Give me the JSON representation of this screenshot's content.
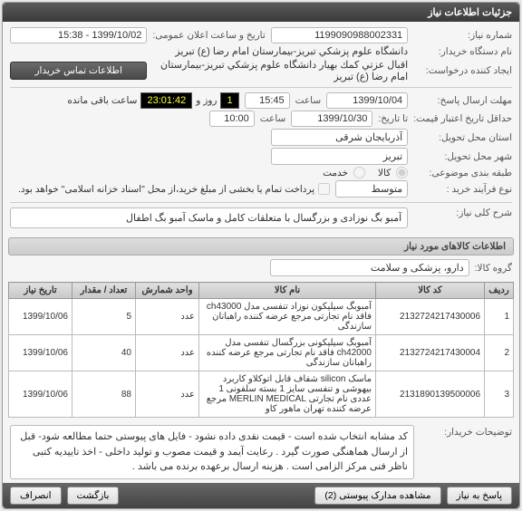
{
  "panel_title": "جزئیات اطلاعات نیاز",
  "fields": {
    "need_no_label": "شماره نیاز:",
    "need_no": "1199090988002331",
    "announce_label": "تاریخ و ساعت اعلان عمومی:",
    "announce": "1399/10/02 - 15:38",
    "buyer_org_label": "نام دستگاه خریدار:",
    "buyer_org": "دانشگاه علوم پزشكي تبريز-بیمارستان امام رضا (ع) تبریز",
    "creator_label": "ایجاد کننده درخواست:",
    "creator": "اقبال عزتي كمك بهيار دانشگاه علوم پزشكي تبريز-بیمارستان امام رضا (ع) تبریز",
    "contact_btn": "اطلاعات تماس خریدار",
    "deadline_label": "مهلت ارسال پاسخ:",
    "deadline_date": "1399/10/04",
    "hour_label": "ساعت",
    "deadline_time": "15:45",
    "remain_days": "1",
    "remain_day_label": "روز و",
    "remain_time": "23:01:42",
    "remain_suffix": "ساعت باقی مانده",
    "min_validity_label": "حداقل تاریخ اعتبار قیمت:",
    "min_validity_empty": "تا تاریخ:",
    "min_validity_date": "1399/10/30",
    "min_validity_time": "10:00",
    "province_label": "استان محل تحویل:",
    "province": "آذربایجان شرقی",
    "city_label": "شهر محل تحویل:",
    "city": "تبریز",
    "budget_label": "طبقه بندی موضوعی:",
    "budget_radio_goods": "کالا",
    "budget_radio_service": "خدمت",
    "process_label": "نوع فرآیند خرید :",
    "process_value": "متوسط",
    "pay_partial_checkbox": "پرداخت تمام یا بخشی از مبلغ خرید،از محل \"اسناد خزانه اسلامی\" خواهد بود.",
    "desc_label": "شرح کلی نیاز:",
    "desc": "آمبو بگ نوزادی و بزرگسال با متعلقات کامل و ماسک آمبو بگ اطفال"
  },
  "section_titles": {
    "items_info": "اطلاعات کالاهای مورد نیاز"
  },
  "group": {
    "label": "گروه کالا:",
    "value": "دارو، پزشکی و سلامت"
  },
  "table": {
    "headers": [
      "ردیف",
      "کد کالا",
      "نام کالا",
      "واحد شمارش",
      "تعداد / مقدار",
      "تاریخ نیاز"
    ],
    "rows": [
      {
        "n": "1",
        "code": "2132724217430006",
        "name": "آمبوبگ سیلیکون نوزاد تنفسی مدل ch43000 فاقد نام تجارتی مرجع عرضه کننده راهبانان سازندگی",
        "unit": "عدد",
        "qty": "5",
        "date": "1399/10/06"
      },
      {
        "n": "2",
        "code": "2132724217430004",
        "name": "آمبوبگ سیلیکونی بزرگسال تنفسی مدل ch42000 فاقد نام تجارتی مرجع عرضه کننده راهبانان سازندگی",
        "unit": "عدد",
        "qty": "40",
        "date": "1399/10/06"
      },
      {
        "n": "3",
        "code": "2131890139500006",
        "name": "ماسک silicon شفاف قابل اتوکلاو کاربرد بیهوشی و تنفسی سایز 1 بسته سلفونی 1 عددی نام تجارتی MERLIN MEDICAL مرجع عرضه کننده تهران ماهور کاو",
        "unit": "عدد",
        "qty": "88",
        "date": "1399/10/06"
      }
    ]
  },
  "buyer_desc": {
    "label": "توضیحات خریدار:",
    "text": "کد مشابه انتخاب شده است - قیمت نقدی داده نشود - فایل های پیوستی حتما مطالعه شود- قبل از ارسال هماهنگی صورت گیرد . رعایت آیمد و قیمت مصوب و تولید داخلی -  اخذ تاییدیه کتبی ناظر فنی مرکز الزامی است . هزینه ارسال برعهده برنده می باشد ."
  },
  "footer": {
    "reply": "پاسخ به نیاز",
    "attachments": "مشاهده مدارک پیوستی",
    "attachments_count": "(2)",
    "back": "بازگشت",
    "cancel": "انصراف"
  }
}
